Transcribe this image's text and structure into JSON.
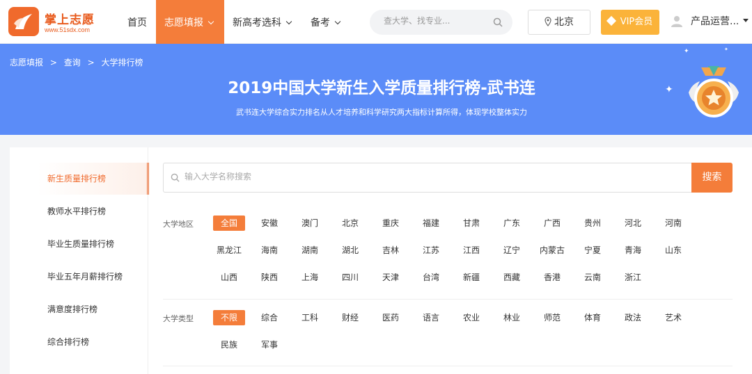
{
  "header": {
    "logo_title": "掌上志愿",
    "logo_url": "www.51sdx.com",
    "nav": [
      {
        "label": "首页",
        "active": false,
        "has_chevron": false
      },
      {
        "label": "志愿填报",
        "active": true,
        "has_chevron": true
      },
      {
        "label": "新高考选科",
        "active": false,
        "has_chevron": true
      },
      {
        "label": "备考",
        "active": false,
        "has_chevron": true
      }
    ],
    "search_placeholder": "查大学、找专业...",
    "location": "北京",
    "vip_label": "VIP会员",
    "user_name": "产品运营..."
  },
  "banner": {
    "breadcrumb": [
      "志愿填报",
      ">",
      "查询",
      ">",
      "大学排行榜"
    ],
    "title": "2019中国大学新生入学质量排行榜-武书连",
    "subtitle": "武书连大学综合实力排名从人才培养和科学研究两大指标计算所得，体现学校整体实力",
    "bg_color": "#5b8cf8"
  },
  "sidebar": {
    "items": [
      {
        "label": "新生质量排行榜",
        "active": true
      },
      {
        "label": "教师水平排行榜",
        "active": false
      },
      {
        "label": "毕业生质量排行榜",
        "active": false
      },
      {
        "label": "毕业五年月薪排行榜",
        "active": false
      },
      {
        "label": "满意度排行榜",
        "active": false
      },
      {
        "label": "综合排行榜",
        "active": false
      }
    ]
  },
  "main": {
    "search_placeholder": "输入大学名称搜索",
    "search_button": "搜索",
    "region": {
      "label": "大学地区",
      "rows": [
        [
          "全国",
          "安徽",
          "澳门",
          "北京",
          "重庆",
          "福建",
          "甘肃",
          "广东",
          "广西",
          "贵州",
          "河北",
          "河南"
        ],
        [
          "黑龙江",
          "海南",
          "湖南",
          "湖北",
          "吉林",
          "江苏",
          "江西",
          "辽宁",
          "内蒙古",
          "宁夏",
          "青海",
          "山东"
        ],
        [
          "山西",
          "陕西",
          "上海",
          "四川",
          "天津",
          "台湾",
          "新疆",
          "西藏",
          "香港",
          "云南",
          "浙江"
        ]
      ],
      "selected": "全国"
    },
    "type": {
      "label": "大学类型",
      "rows": [
        [
          "不限",
          "综合",
          "工科",
          "财经",
          "医药",
          "语言",
          "农业",
          "林业",
          "师范",
          "体育",
          "政法",
          "艺术"
        ],
        [
          "民族",
          "军事"
        ]
      ],
      "selected": "不限"
    }
  },
  "colors": {
    "accent": "#f47d3a",
    "vip": "#fbb33a",
    "banner": "#5b8cf8"
  }
}
